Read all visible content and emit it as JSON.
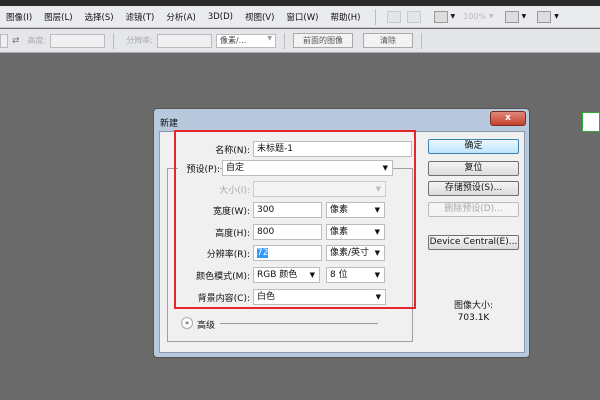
{
  "menubar": {
    "items": [
      "图像(I)",
      "图层(L)",
      "选择(S)",
      "滤镜(T)",
      "分析(A)",
      "3D(D)",
      "视图(V)",
      "窗口(W)",
      "帮助(H)"
    ],
    "zoom": "100%"
  },
  "options_bar": {
    "height_label": "高度:",
    "resolution_label": "分辨率:",
    "unit": "像素/...",
    "front_image_button": "前面的图像",
    "clear_button": "清除"
  },
  "dialog": {
    "title": "新建",
    "close": "x",
    "name_label": "名称(N):",
    "name_value": "未标题-1",
    "preset_label": "预设(P):",
    "preset_value": "自定",
    "size_label": "大小(I):",
    "size_value": "",
    "width_label": "宽度(W):",
    "width_value": "300",
    "width_unit": "像素",
    "height_label": "高度(H):",
    "height_value": "800",
    "height_unit": "像素",
    "resolution_label": "分辨率(R):",
    "resolution_value": "72",
    "resolution_unit": "像素/英寸",
    "color_mode_label": "颜色模式(M):",
    "color_mode_value": "RGB 颜色",
    "bit_depth_value": "8 位",
    "background_label": "背景内容(C):",
    "background_value": "白色",
    "advanced_label": "高级",
    "buttons": {
      "ok": "确定",
      "reset": "复位",
      "save_preset": "存储预设(S)...",
      "delete_preset": "删除预设(D)...",
      "device_central": "Device Central(E)..."
    },
    "image_size_label": "图像大小:",
    "image_size_value": "703.1K"
  },
  "colors": {
    "highlight_box": "#e5262b",
    "workspace": "#6a6a6a"
  }
}
